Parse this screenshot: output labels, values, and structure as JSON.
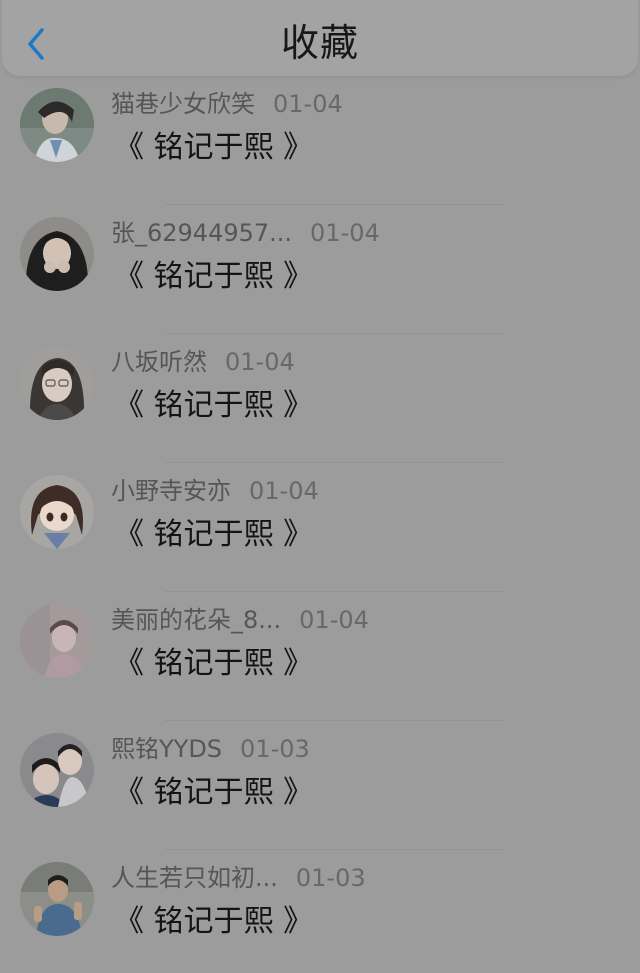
{
  "header": {
    "title": "收藏",
    "back_icon": "chevron-left-icon",
    "back_color": "#1e78c8"
  },
  "items": [
    {
      "user": "猫巷少女欣笑",
      "date": "01-04",
      "text": "《 铭记于熙 》",
      "avatar": "avatar-photo"
    },
    {
      "user": "张_62944957...",
      "date": "01-04",
      "text": "《 铭记于熙 》",
      "avatar": "avatar-photo"
    },
    {
      "user": "八坂听然",
      "date": "01-04",
      "text": "《 铭记于熙 》",
      "avatar": "avatar-photo"
    },
    {
      "user": "小野寺安亦",
      "date": "01-04",
      "text": "《 铭记于熙 》",
      "avatar": "avatar-photo"
    },
    {
      "user": "美丽的花朵_8...",
      "date": "01-04",
      "text": "《 铭记于熙 》",
      "avatar": "avatar-photo"
    },
    {
      "user": "熙铭YYDS",
      "date": "01-03",
      "text": "《 铭记于熙 》",
      "avatar": "avatar-photo"
    },
    {
      "user": "人生若只如初...",
      "date": "01-03",
      "text": "《 铭记于熙 》",
      "avatar": "avatar-photo"
    }
  ]
}
